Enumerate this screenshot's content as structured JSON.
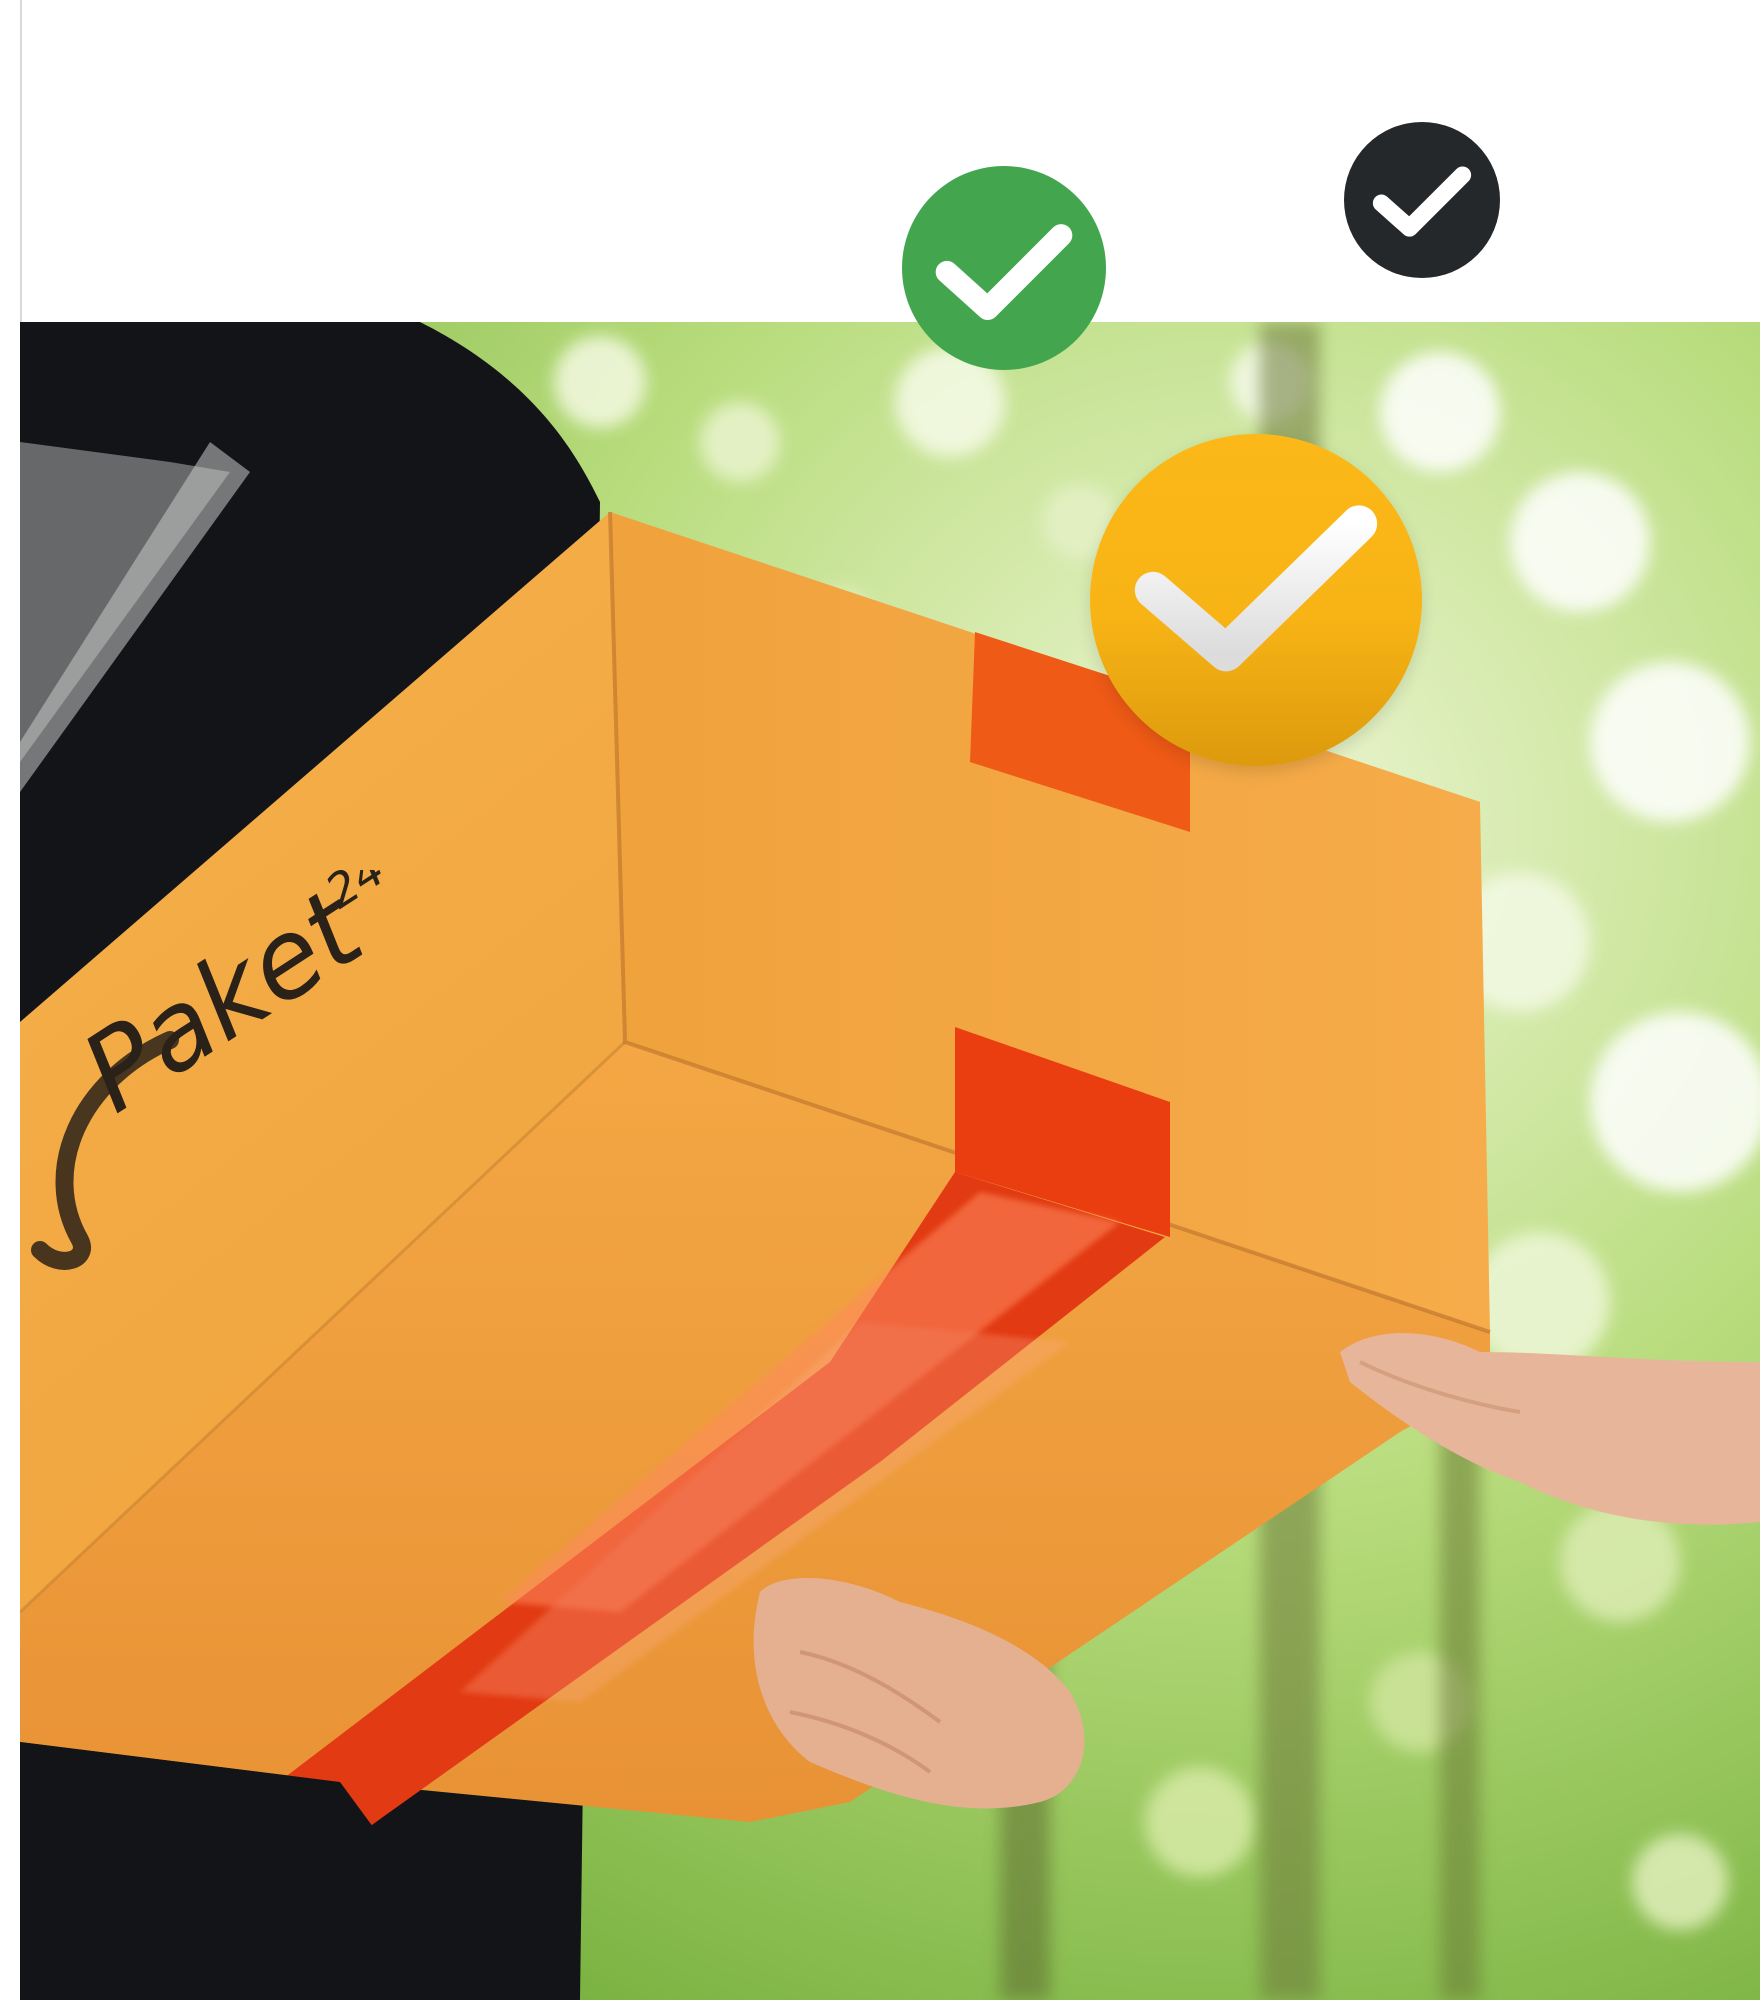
{
  "scene": {
    "description_free": true,
    "brand": {
      "name": "Paket",
      "superscript": "24"
    }
  },
  "badges": [
    {
      "id": "green",
      "color": "#43a64f",
      "icon": "checkmark-icon"
    },
    {
      "id": "dark",
      "color": "#25282b",
      "icon": "checkmark-icon"
    },
    {
      "id": "yellow",
      "color": "#fbb818",
      "icon": "checkmark-icon"
    }
  ],
  "colors": {
    "box_cardboard": "#f2a33f",
    "tape_red": "#e23a12",
    "foliage_green": "#8cc84a",
    "shirt_dark": "#121418"
  }
}
